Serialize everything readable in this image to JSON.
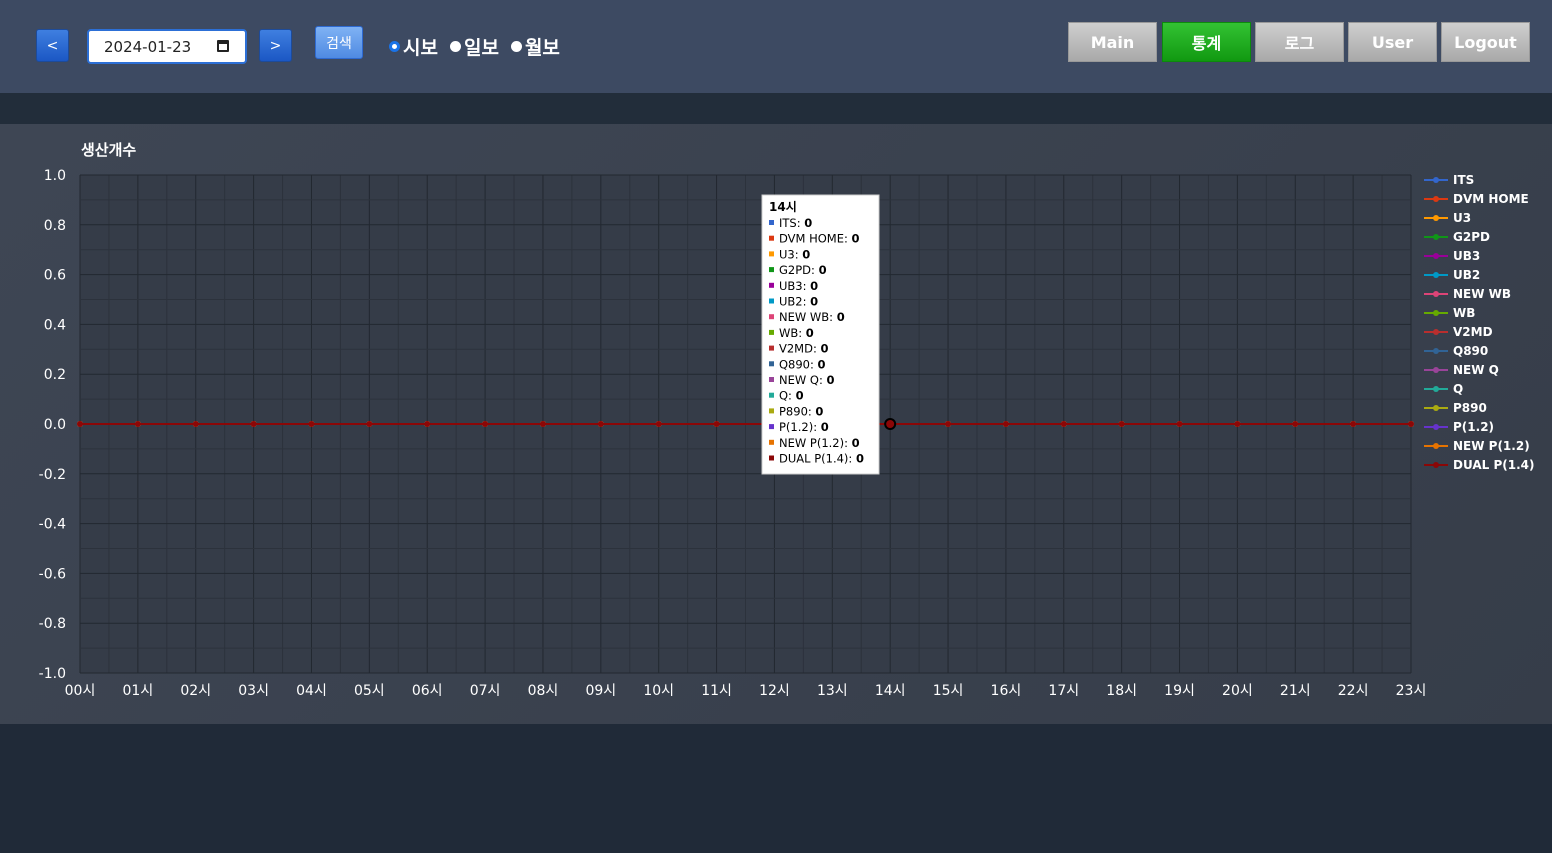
{
  "toolbar": {
    "prev_label": "<",
    "next_label": ">",
    "date_value": "2024-01-23",
    "search_label": "검색",
    "radios": [
      {
        "label": "시보",
        "selected": true
      },
      {
        "label": "일보",
        "selected": false
      },
      {
        "label": "월보",
        "selected": false
      }
    ]
  },
  "menu": [
    {
      "label": "Main",
      "active": false
    },
    {
      "label": "통계",
      "active": true
    },
    {
      "label": "로그",
      "active": false
    },
    {
      "label": "User",
      "active": false
    },
    {
      "label": "Logout",
      "active": false
    }
  ],
  "tooltip": {
    "title": "14시",
    "rows": [
      {
        "name": "ITS",
        "value": "0"
      },
      {
        "name": "DVM HOME",
        "value": "0"
      },
      {
        "name": "U3",
        "value": "0"
      },
      {
        "name": "G2PD",
        "value": "0"
      },
      {
        "name": "UB3",
        "value": "0"
      },
      {
        "name": "UB2",
        "value": "0"
      },
      {
        "name": "NEW WB",
        "value": "0"
      },
      {
        "name": "WB",
        "value": "0"
      },
      {
        "name": "V2MD",
        "value": "0"
      },
      {
        "name": "Q890",
        "value": "0"
      },
      {
        "name": "NEW Q",
        "value": "0"
      },
      {
        "name": "Q",
        "value": "0"
      },
      {
        "name": "P890",
        "value": "0"
      },
      {
        "name": "P(1.2)",
        "value": "0"
      },
      {
        "name": "NEW P(1.2)",
        "value": "0"
      },
      {
        "name": "DUAL P(1.4)",
        "value": "0"
      }
    ]
  },
  "chart_data": {
    "type": "line",
    "title": "생산개수",
    "ylim": [
      -1.0,
      1.0
    ],
    "yticks": [
      "1.0",
      "0.8",
      "0.6",
      "0.4",
      "0.2",
      "0.0",
      "-0.2",
      "-0.4",
      "-0.6",
      "-0.8",
      "-1.0"
    ],
    "x": [
      "00시",
      "01시",
      "02시",
      "03시",
      "04시",
      "05시",
      "06시",
      "07시",
      "08시",
      "09시",
      "10시",
      "11시",
      "12시",
      "13시",
      "14시",
      "15시",
      "16시",
      "17시",
      "18시",
      "19시",
      "20시",
      "21시",
      "22시",
      "23시"
    ],
    "grid": true,
    "legend_position": "right",
    "highlight_x": "14시",
    "series": [
      {
        "name": "ITS",
        "color": "#3366cc",
        "values": [
          0,
          0,
          0,
          0,
          0,
          0,
          0,
          0,
          0,
          0,
          0,
          0,
          0,
          0,
          0,
          0,
          0,
          0,
          0,
          0,
          0,
          0,
          0,
          0
        ]
      },
      {
        "name": "DVM HOME",
        "color": "#dc3912",
        "values": [
          0,
          0,
          0,
          0,
          0,
          0,
          0,
          0,
          0,
          0,
          0,
          0,
          0,
          0,
          0,
          0,
          0,
          0,
          0,
          0,
          0,
          0,
          0,
          0
        ]
      },
      {
        "name": "U3",
        "color": "#ff9900",
        "values": [
          0,
          0,
          0,
          0,
          0,
          0,
          0,
          0,
          0,
          0,
          0,
          0,
          0,
          0,
          0,
          0,
          0,
          0,
          0,
          0,
          0,
          0,
          0,
          0
        ]
      },
      {
        "name": "G2PD",
        "color": "#109618",
        "values": [
          0,
          0,
          0,
          0,
          0,
          0,
          0,
          0,
          0,
          0,
          0,
          0,
          0,
          0,
          0,
          0,
          0,
          0,
          0,
          0,
          0,
          0,
          0,
          0
        ]
      },
      {
        "name": "UB3",
        "color": "#990099",
        "values": [
          0,
          0,
          0,
          0,
          0,
          0,
          0,
          0,
          0,
          0,
          0,
          0,
          0,
          0,
          0,
          0,
          0,
          0,
          0,
          0,
          0,
          0,
          0,
          0
        ]
      },
      {
        "name": "UB2",
        "color": "#0099c6",
        "values": [
          0,
          0,
          0,
          0,
          0,
          0,
          0,
          0,
          0,
          0,
          0,
          0,
          0,
          0,
          0,
          0,
          0,
          0,
          0,
          0,
          0,
          0,
          0,
          0
        ]
      },
      {
        "name": "NEW WB",
        "color": "#dd4477",
        "values": [
          0,
          0,
          0,
          0,
          0,
          0,
          0,
          0,
          0,
          0,
          0,
          0,
          0,
          0,
          0,
          0,
          0,
          0,
          0,
          0,
          0,
          0,
          0,
          0
        ]
      },
      {
        "name": "WB",
        "color": "#66aa00",
        "values": [
          0,
          0,
          0,
          0,
          0,
          0,
          0,
          0,
          0,
          0,
          0,
          0,
          0,
          0,
          0,
          0,
          0,
          0,
          0,
          0,
          0,
          0,
          0,
          0
        ]
      },
      {
        "name": "V2MD",
        "color": "#b82e2e",
        "values": [
          0,
          0,
          0,
          0,
          0,
          0,
          0,
          0,
          0,
          0,
          0,
          0,
          0,
          0,
          0,
          0,
          0,
          0,
          0,
          0,
          0,
          0,
          0,
          0
        ]
      },
      {
        "name": "Q890",
        "color": "#316395",
        "values": [
          0,
          0,
          0,
          0,
          0,
          0,
          0,
          0,
          0,
          0,
          0,
          0,
          0,
          0,
          0,
          0,
          0,
          0,
          0,
          0,
          0,
          0,
          0,
          0
        ]
      },
      {
        "name": "NEW Q",
        "color": "#994499",
        "values": [
          0,
          0,
          0,
          0,
          0,
          0,
          0,
          0,
          0,
          0,
          0,
          0,
          0,
          0,
          0,
          0,
          0,
          0,
          0,
          0,
          0,
          0,
          0,
          0
        ]
      },
      {
        "name": "Q",
        "color": "#22aa99",
        "values": [
          0,
          0,
          0,
          0,
          0,
          0,
          0,
          0,
          0,
          0,
          0,
          0,
          0,
          0,
          0,
          0,
          0,
          0,
          0,
          0,
          0,
          0,
          0,
          0
        ]
      },
      {
        "name": "P890",
        "color": "#aaaa11",
        "values": [
          0,
          0,
          0,
          0,
          0,
          0,
          0,
          0,
          0,
          0,
          0,
          0,
          0,
          0,
          0,
          0,
          0,
          0,
          0,
          0,
          0,
          0,
          0,
          0
        ]
      },
      {
        "name": "P(1.2)",
        "color": "#6633cc",
        "values": [
          0,
          0,
          0,
          0,
          0,
          0,
          0,
          0,
          0,
          0,
          0,
          0,
          0,
          0,
          0,
          0,
          0,
          0,
          0,
          0,
          0,
          0,
          0,
          0
        ]
      },
      {
        "name": "NEW P(1.2)",
        "color": "#e67300",
        "values": [
          0,
          0,
          0,
          0,
          0,
          0,
          0,
          0,
          0,
          0,
          0,
          0,
          0,
          0,
          0,
          0,
          0,
          0,
          0,
          0,
          0,
          0,
          0,
          0
        ]
      },
      {
        "name": "DUAL P(1.4)",
        "color": "#8b0707",
        "values": [
          0,
          0,
          0,
          0,
          0,
          0,
          0,
          0,
          0,
          0,
          0,
          0,
          0,
          0,
          0,
          0,
          0,
          0,
          0,
          0,
          0,
          0,
          0,
          0
        ]
      }
    ]
  }
}
